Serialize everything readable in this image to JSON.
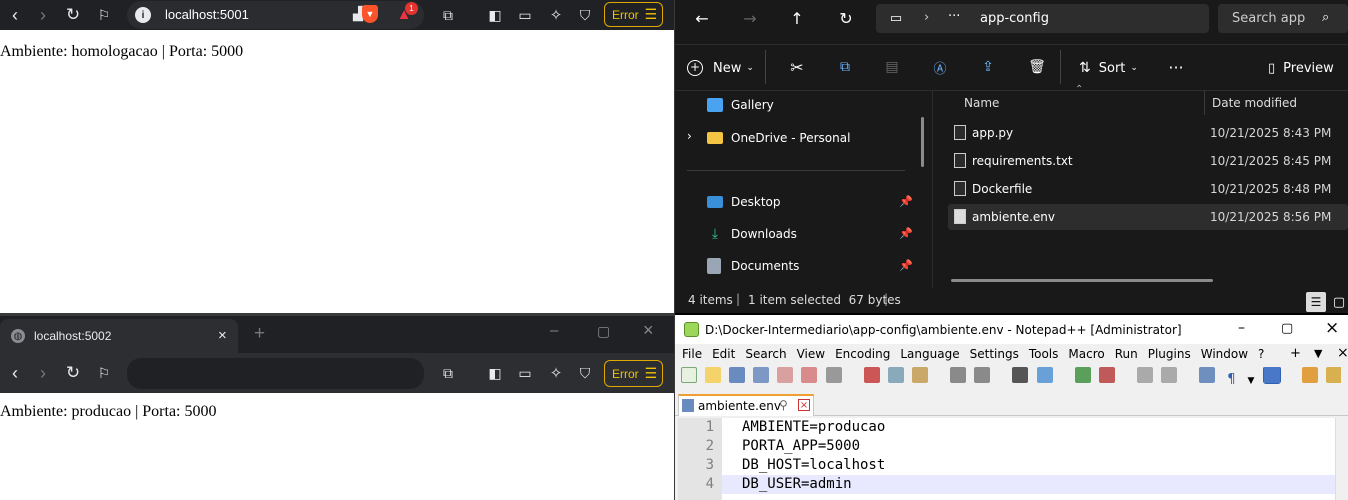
{
  "browser_top": {
    "url": "localhost:5001",
    "page_text": "Ambiente: homologacao | Porta: 5000",
    "error_label": "Error",
    "notif_count": "1"
  },
  "browser_bottom": {
    "tab_title": "localhost:5002",
    "page_text": "Ambiente: producao | Porta: 5000",
    "error_label": "Error",
    "url": ""
  },
  "explorer": {
    "path_current": "app-config",
    "path_ellipsis": "···",
    "search_placeholder": "Search app",
    "toolbar": {
      "new_label": "New",
      "sort_label": "Sort",
      "preview_label": "Preview"
    },
    "columns": {
      "name": "Name",
      "date": "Date modified"
    },
    "nav": [
      {
        "label": "Gallery"
      },
      {
        "label": "OneDrive - Personal"
      },
      {
        "label": "Desktop"
      },
      {
        "label": "Downloads"
      },
      {
        "label": "Documents"
      }
    ],
    "files": [
      {
        "name": "app.py",
        "date": "10/21/2025 8:43 PM"
      },
      {
        "name": "requirements.txt",
        "date": "10/21/2025 8:45 PM"
      },
      {
        "name": "Dockerfile",
        "date": "10/21/2025 8:48 PM"
      },
      {
        "name": "ambiente.env",
        "date": "10/21/2025 8:56 PM"
      }
    ],
    "status": {
      "items": "4 items",
      "selected": "1 item selected  67 bytes"
    }
  },
  "notepad": {
    "title": "D:\\Docker-Intermediario\\app-config\\ambiente.env - Notepad++ [Administrator]",
    "menu": [
      "File",
      "Edit",
      "Search",
      "View",
      "Encoding",
      "Language",
      "Settings",
      "Tools",
      "Macro",
      "Run",
      "Plugins",
      "Window",
      "?"
    ],
    "tab_name": "ambiente.env",
    "lines": [
      {
        "num": "1",
        "text": "AMBIENTE=producao"
      },
      {
        "num": "2",
        "text": "PORTA_APP=5000"
      },
      {
        "num": "3",
        "text": "DB_HOST=localhost"
      },
      {
        "num": "4",
        "text": "DB_USER=admin"
      }
    ]
  }
}
